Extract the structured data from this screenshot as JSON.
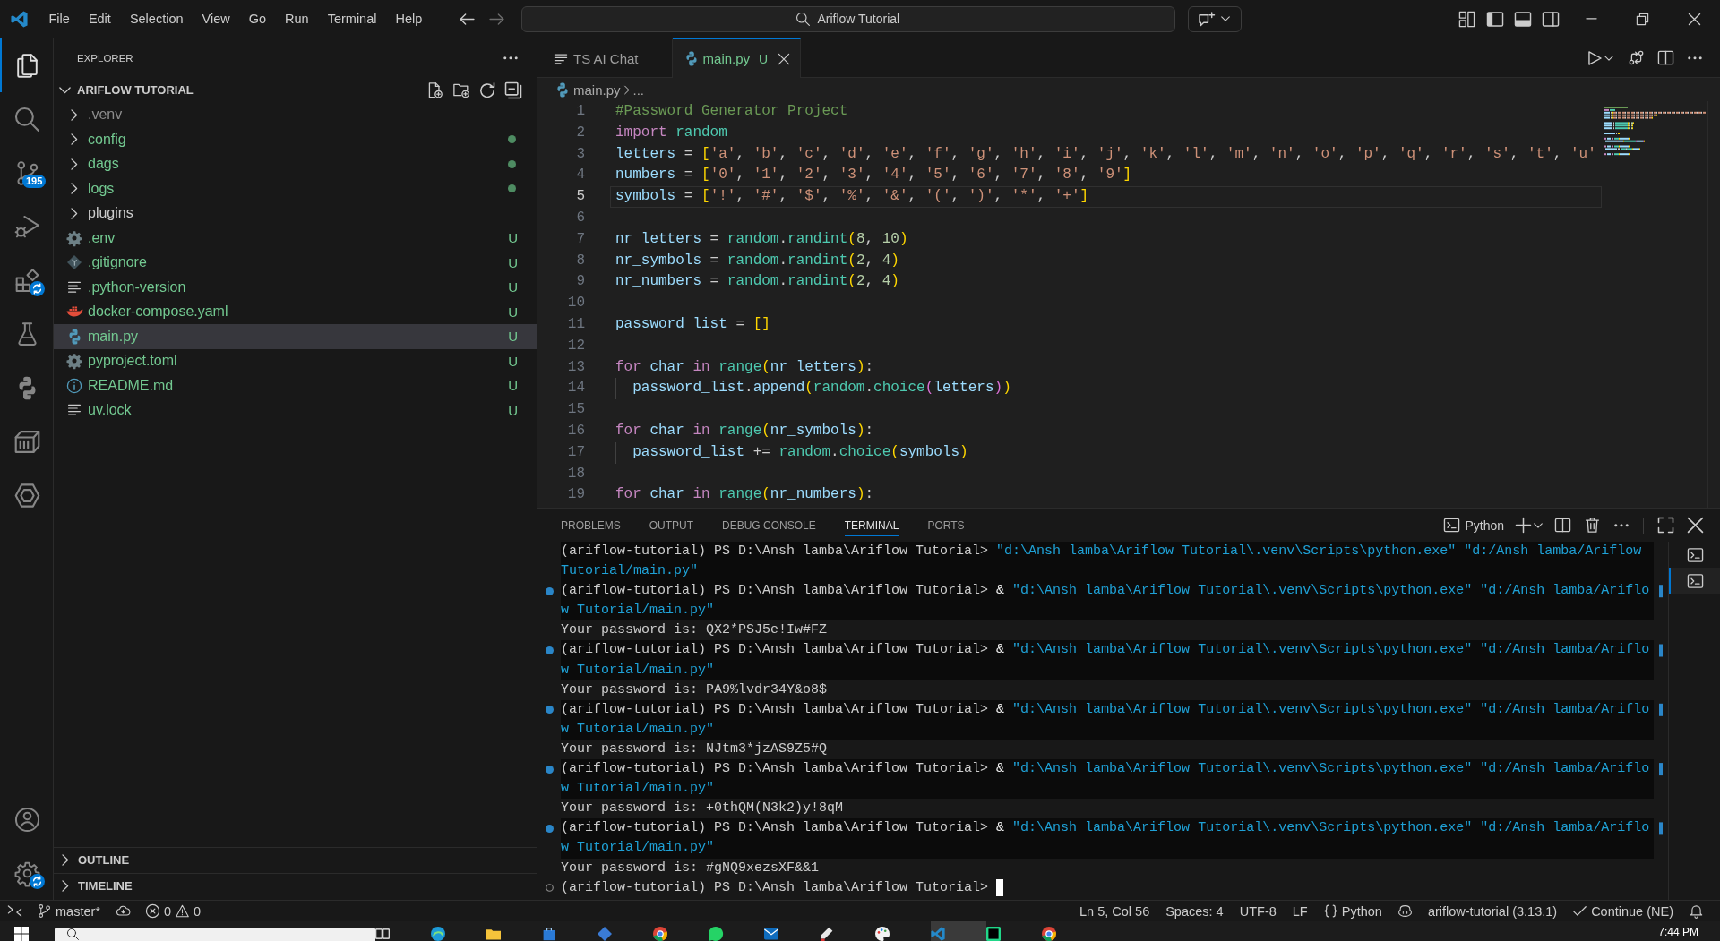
{
  "title_bar": {
    "menu": [
      "File",
      "Edit",
      "Selection",
      "View",
      "Go",
      "Run",
      "Terminal",
      "Help"
    ],
    "nav": [
      {
        "kind": "back",
        "disabled": false
      },
      {
        "kind": "forward",
        "disabled": true
      }
    ],
    "command_center": "Ariflow Tutorial",
    "layout": [
      {
        "kind": "primary-sidebar",
        "on": true
      },
      {
        "kind": "panel",
        "on": true
      },
      {
        "kind": "secondary-sidebar",
        "on": false
      }
    ]
  },
  "activity_bar": {
    "items": [
      {
        "kind": "explorer",
        "selected": true,
        "syncing": false
      },
      {
        "kind": "search",
        "selected": false,
        "syncing": false
      },
      {
        "kind": "source-control",
        "selected": false,
        "syncing": false,
        "badge": "195"
      },
      {
        "kind": "run-debug",
        "selected": false,
        "syncing": false
      },
      {
        "kind": "extensions",
        "selected": false,
        "syncing": true
      },
      {
        "kind": "testing",
        "selected": false,
        "syncing": false
      },
      {
        "kind": "python",
        "selected": false,
        "syncing": false
      },
      {
        "kind": "containers",
        "selected": false,
        "syncing": false
      },
      {
        "kind": "hexagon",
        "selected": false,
        "syncing": false
      }
    ],
    "bottom": [
      {
        "kind": "account",
        "syncing": false
      },
      {
        "kind": "manage",
        "syncing": true
      }
    ]
  },
  "sidebar": {
    "title": "EXPLORER",
    "root": {
      "label": "ARIFLOW TUTORIAL",
      "expanded": true,
      "children": [
        {
          "label": ".venv",
          "kind": "folder",
          "expanded": false,
          "ignored": true,
          "untracked": false,
          "selected": false
        },
        {
          "label": "config",
          "kind": "folder",
          "expanded": false,
          "ignored": false,
          "untracked": true,
          "selected": false
        },
        {
          "label": "dags",
          "kind": "folder",
          "expanded": false,
          "ignored": false,
          "untracked": true,
          "selected": false
        },
        {
          "label": "logs",
          "kind": "folder",
          "expanded": false,
          "ignored": false,
          "untracked": true,
          "selected": false
        },
        {
          "label": "plugins",
          "kind": "folder",
          "expanded": false,
          "ignored": false,
          "untracked": false,
          "selected": false
        },
        {
          "label": ".env",
          "kind": "settings",
          "ignored": false,
          "untracked": true,
          "badge": "U",
          "selected": false
        },
        {
          "label": ".gitignore",
          "kind": "git",
          "ignored": false,
          "untracked": true,
          "badge": "U",
          "selected": false
        },
        {
          "label": ".python-version",
          "kind": "text",
          "ignored": false,
          "untracked": true,
          "badge": "U",
          "selected": false
        },
        {
          "label": "docker-compose.yaml",
          "kind": "docker",
          "ignored": false,
          "untracked": true,
          "badge": "U",
          "selected": false
        },
        {
          "label": "main.py",
          "kind": "python",
          "ignored": false,
          "untracked": true,
          "badge": "U",
          "selected": true
        },
        {
          "label": "pyproject.toml",
          "kind": "settings",
          "ignored": false,
          "untracked": true,
          "badge": "U",
          "selected": false
        },
        {
          "label": "README.md",
          "kind": "info",
          "ignored": false,
          "untracked": true,
          "badge": "U",
          "selected": false
        },
        {
          "label": "uv.lock",
          "kind": "text",
          "ignored": false,
          "untracked": true,
          "badge": "U",
          "selected": false
        }
      ]
    },
    "sections": [
      {
        "label": "OUTLINE",
        "expanded": false
      },
      {
        "label": "TIMELINE",
        "expanded": false
      }
    ]
  },
  "editor": {
    "tabs": [
      {
        "label": "TS AI Chat",
        "kind": "chat",
        "untracked": false,
        "selected": false
      },
      {
        "label": "main.py",
        "kind": "python",
        "untracked": true,
        "badge": "U",
        "selected": true
      }
    ],
    "breadcrumb": [
      "main.py",
      "..."
    ],
    "lines": [
      {
        "number": "1",
        "current": false,
        "indented": false,
        "tokens": [
          {
            "kind": "comment",
            "text": "#Password Generator Project"
          }
        ]
      },
      {
        "number": "2",
        "current": false,
        "indented": false,
        "tokens": [
          {
            "kind": "keyword",
            "text": "import"
          },
          {
            "kind": "entity",
            "text": " random"
          }
        ]
      },
      {
        "number": "3",
        "current": false,
        "indented": false,
        "tokens": [
          {
            "kind": "name",
            "text": "letters"
          },
          {
            "kind": "plain",
            "text": " = "
          },
          {
            "kind": "bracket1",
            "text": "["
          },
          {
            "kind": "string",
            "text": "'a'"
          },
          {
            "kind": "plain",
            "text": ", "
          },
          {
            "kind": "string",
            "text": "'b'"
          },
          {
            "kind": "plain",
            "text": ", "
          },
          {
            "kind": "string",
            "text": "'c'"
          },
          {
            "kind": "plain",
            "text": ", "
          },
          {
            "kind": "string",
            "text": "'d'"
          },
          {
            "kind": "plain",
            "text": ", "
          },
          {
            "kind": "string",
            "text": "'e'"
          },
          {
            "kind": "plain",
            "text": ", "
          },
          {
            "kind": "string",
            "text": "'f'"
          },
          {
            "kind": "plain",
            "text": ", "
          },
          {
            "kind": "string",
            "text": "'g'"
          },
          {
            "kind": "plain",
            "text": ", "
          },
          {
            "kind": "string",
            "text": "'h'"
          },
          {
            "kind": "plain",
            "text": ", "
          },
          {
            "kind": "string",
            "text": "'i'"
          },
          {
            "kind": "plain",
            "text": ", "
          },
          {
            "kind": "string",
            "text": "'j'"
          },
          {
            "kind": "plain",
            "text": ", "
          },
          {
            "kind": "string",
            "text": "'k'"
          },
          {
            "kind": "plain",
            "text": ", "
          },
          {
            "kind": "string",
            "text": "'l'"
          },
          {
            "kind": "plain",
            "text": ", "
          },
          {
            "kind": "string",
            "text": "'m'"
          },
          {
            "kind": "plain",
            "text": ", "
          },
          {
            "kind": "string",
            "text": "'n'"
          },
          {
            "kind": "plain",
            "text": ", "
          },
          {
            "kind": "string",
            "text": "'o'"
          },
          {
            "kind": "plain",
            "text": ", "
          },
          {
            "kind": "string",
            "text": "'p'"
          },
          {
            "kind": "plain",
            "text": ", "
          },
          {
            "kind": "string",
            "text": "'q'"
          },
          {
            "kind": "plain",
            "text": ", "
          },
          {
            "kind": "string",
            "text": "'r'"
          },
          {
            "kind": "plain",
            "text": ", "
          },
          {
            "kind": "string",
            "text": "'s'"
          },
          {
            "kind": "plain",
            "text": ", "
          },
          {
            "kind": "string",
            "text": "'t'"
          },
          {
            "kind": "plain",
            "text": ", "
          },
          {
            "kind": "string",
            "text": "'u'"
          }
        ]
      },
      {
        "number": "4",
        "current": false,
        "indented": false,
        "tokens": [
          {
            "kind": "name",
            "text": "numbers"
          },
          {
            "kind": "plain",
            "text": " = "
          },
          {
            "kind": "bracket1",
            "text": "["
          },
          {
            "kind": "string",
            "text": "'0'"
          },
          {
            "kind": "plain",
            "text": ", "
          },
          {
            "kind": "string",
            "text": "'1'"
          },
          {
            "kind": "plain",
            "text": ", "
          },
          {
            "kind": "string",
            "text": "'2'"
          },
          {
            "kind": "plain",
            "text": ", "
          },
          {
            "kind": "string",
            "text": "'3'"
          },
          {
            "kind": "plain",
            "text": ", "
          },
          {
            "kind": "string",
            "text": "'4'"
          },
          {
            "kind": "plain",
            "text": ", "
          },
          {
            "kind": "string",
            "text": "'5'"
          },
          {
            "kind": "plain",
            "text": ", "
          },
          {
            "kind": "string",
            "text": "'6'"
          },
          {
            "kind": "plain",
            "text": ", "
          },
          {
            "kind": "string",
            "text": "'7'"
          },
          {
            "kind": "plain",
            "text": ", "
          },
          {
            "kind": "string",
            "text": "'8'"
          },
          {
            "kind": "plain",
            "text": ", "
          },
          {
            "kind": "string",
            "text": "'9'"
          },
          {
            "kind": "bracket1",
            "text": "]"
          }
        ]
      },
      {
        "number": "5",
        "current": true,
        "indented": false,
        "tokens": [
          {
            "kind": "name",
            "text": "symbols"
          },
          {
            "kind": "plain",
            "text": " = "
          },
          {
            "kind": "bracket1",
            "text": "["
          },
          {
            "kind": "string",
            "text": "'!'"
          },
          {
            "kind": "plain",
            "text": ", "
          },
          {
            "kind": "string",
            "text": "'#'"
          },
          {
            "kind": "plain",
            "text": ", "
          },
          {
            "kind": "string",
            "text": "'$'"
          },
          {
            "kind": "plain",
            "text": ", "
          },
          {
            "kind": "string",
            "text": "'%'"
          },
          {
            "kind": "plain",
            "text": ", "
          },
          {
            "kind": "string",
            "text": "'&'"
          },
          {
            "kind": "plain",
            "text": ", "
          },
          {
            "kind": "string",
            "text": "'('"
          },
          {
            "kind": "plain",
            "text": ", "
          },
          {
            "kind": "string",
            "text": "')'"
          },
          {
            "kind": "plain",
            "text": ", "
          },
          {
            "kind": "string",
            "text": "'*'"
          },
          {
            "kind": "plain",
            "text": ", "
          },
          {
            "kind": "string",
            "text": "'+'"
          },
          {
            "kind": "bracket1",
            "text": "]"
          }
        ]
      },
      {
        "number": "6",
        "current": false
      },
      {
        "number": "7",
        "current": false,
        "indented": false,
        "tokens": [
          {
            "kind": "name",
            "text": "nr_letters"
          },
          {
            "kind": "plain",
            "text": " = "
          },
          {
            "kind": "entity",
            "text": "random"
          },
          {
            "kind": "plain",
            "text": "."
          },
          {
            "kind": "entity",
            "text": "randint"
          },
          {
            "kind": "bracket1",
            "text": "("
          },
          {
            "kind": "number",
            "text": "8"
          },
          {
            "kind": "plain",
            "text": ", "
          },
          {
            "kind": "number",
            "text": "10"
          },
          {
            "kind": "bracket1",
            "text": ")"
          }
        ]
      },
      {
        "number": "8",
        "current": false,
        "indented": false,
        "tokens": [
          {
            "kind": "name",
            "text": "nr_symbols"
          },
          {
            "kind": "plain",
            "text": " = "
          },
          {
            "kind": "entity",
            "text": "random"
          },
          {
            "kind": "plain",
            "text": "."
          },
          {
            "kind": "entity",
            "text": "randint"
          },
          {
            "kind": "bracket1",
            "text": "("
          },
          {
            "kind": "number",
            "text": "2"
          },
          {
            "kind": "plain",
            "text": ", "
          },
          {
            "kind": "number",
            "text": "4"
          },
          {
            "kind": "bracket1",
            "text": ")"
          }
        ]
      },
      {
        "number": "9",
        "current": false,
        "indented": false,
        "tokens": [
          {
            "kind": "name",
            "text": "nr_numbers"
          },
          {
            "kind": "plain",
            "text": " = "
          },
          {
            "kind": "entity",
            "text": "random"
          },
          {
            "kind": "plain",
            "text": "."
          },
          {
            "kind": "entity",
            "text": "randint"
          },
          {
            "kind": "bracket1",
            "text": "("
          },
          {
            "kind": "number",
            "text": "2"
          },
          {
            "kind": "plain",
            "text": ", "
          },
          {
            "kind": "number",
            "text": "4"
          },
          {
            "kind": "bracket1",
            "text": ")"
          }
        ]
      },
      {
        "number": "10",
        "current": false
      },
      {
        "number": "11",
        "current": false,
        "indented": false,
        "tokens": [
          {
            "kind": "name",
            "text": "password_list"
          },
          {
            "kind": "plain",
            "text": " = "
          },
          {
            "kind": "bracket1",
            "text": "[]"
          }
        ]
      },
      {
        "number": "12",
        "current": false
      },
      {
        "number": "13",
        "current": false,
        "indented": false,
        "tokens": [
          {
            "kind": "keyword",
            "text": "for"
          },
          {
            "kind": "name",
            "text": " char"
          },
          {
            "kind": "keyword",
            "text": " in"
          },
          {
            "kind": "entity",
            "text": " range"
          },
          {
            "kind": "bracket1",
            "text": "("
          },
          {
            "kind": "name",
            "text": "nr_letters"
          },
          {
            "kind": "bracket1",
            "text": ")"
          },
          {
            "kind": "plain",
            "text": ":"
          }
        ]
      },
      {
        "number": "14",
        "current": false,
        "indented": true,
        "tokens": [
          {
            "kind": "name",
            "text": "password_list"
          },
          {
            "kind": "plain",
            "text": "."
          },
          {
            "kind": "name",
            "text": "append"
          },
          {
            "kind": "bracket1",
            "text": "("
          },
          {
            "kind": "entity",
            "text": "random"
          },
          {
            "kind": "plain",
            "text": "."
          },
          {
            "kind": "entity",
            "text": "choice"
          },
          {
            "kind": "bracket2",
            "text": "("
          },
          {
            "kind": "name",
            "text": "letters"
          },
          {
            "kind": "bracket2",
            "text": ")"
          },
          {
            "kind": "bracket1",
            "text": ")"
          }
        ]
      },
      {
        "number": "15",
        "current": false
      },
      {
        "number": "16",
        "current": false,
        "indented": false,
        "tokens": [
          {
            "kind": "keyword",
            "text": "for"
          },
          {
            "kind": "name",
            "text": " char"
          },
          {
            "kind": "keyword",
            "text": " in"
          },
          {
            "kind": "entity",
            "text": " range"
          },
          {
            "kind": "bracket1",
            "text": "("
          },
          {
            "kind": "name",
            "text": "nr_symbols"
          },
          {
            "kind": "bracket1",
            "text": ")"
          },
          {
            "kind": "plain",
            "text": ":"
          }
        ]
      },
      {
        "number": "17",
        "current": false,
        "indented": true,
        "tokens": [
          {
            "kind": "name",
            "text": "password_list"
          },
          {
            "kind": "plain",
            "text": " += "
          },
          {
            "kind": "entity",
            "text": "random"
          },
          {
            "kind": "plain",
            "text": "."
          },
          {
            "kind": "entity",
            "text": "choice"
          },
          {
            "kind": "bracket1",
            "text": "("
          },
          {
            "kind": "name",
            "text": "symbols"
          },
          {
            "kind": "bracket1",
            "text": ")"
          }
        ]
      },
      {
        "number": "18",
        "current": false
      },
      {
        "number": "19",
        "current": false,
        "indented": false,
        "tokens": [
          {
            "kind": "keyword",
            "text": "for"
          },
          {
            "kind": "name",
            "text": " char"
          },
          {
            "kind": "keyword",
            "text": " in"
          },
          {
            "kind": "entity",
            "text": " range"
          },
          {
            "kind": "bracket1",
            "text": "("
          },
          {
            "kind": "name",
            "text": "nr_numbers"
          },
          {
            "kind": "bracket1",
            "text": ")"
          },
          {
            "kind": "plain",
            "text": ":"
          }
        ]
      }
    ]
  },
  "panel": {
    "tabs": [
      {
        "label": "PROBLEMS",
        "selected": false
      },
      {
        "label": "OUTPUT",
        "selected": false
      },
      {
        "label": "DEBUG CONSOLE",
        "selected": false
      },
      {
        "label": "TERMINAL",
        "selected": true
      },
      {
        "label": "PORTS",
        "selected": false
      }
    ],
    "shell": "Python",
    "terminal_list": [
      {
        "selected": false
      },
      {
        "selected": true
      }
    ],
    "terminal": [
      {
        "kind": "command",
        "succeeded": false,
        "prompt": "(ariflow-tutorial) PS D:\\Ansh lamba\\Ariflow Tutorial>",
        "args": "\"d:\\Ansh lamba\\Ariflow Tutorial\\.venv\\Scripts\\python.exe\" \"d:/Ansh lamba/Ariflow"
      },
      {
        "kind": "wrap",
        "text": "Tutorial/main.py\""
      },
      {
        "kind": "command",
        "succeeded": true,
        "prompt": "(ariflow-tutorial) PS D:\\Ansh lamba\\Ariflow Tutorial>",
        "operator": "&",
        "args": "\"d:\\Ansh lamba\\Ariflow Tutorial\\.venv\\Scripts\\python.exe\" \"d:/Ansh lamba/Ariflo"
      },
      {
        "kind": "wrap",
        "text": "w Tutorial/main.py\""
      },
      {
        "kind": "output",
        "text": "Your password is: QX2*PSJ5e!Iw#FZ"
      },
      {
        "kind": "command",
        "succeeded": true,
        "prompt": "(ariflow-tutorial) PS D:\\Ansh lamba\\Ariflow Tutorial>",
        "operator": "&",
        "args": "\"d:\\Ansh lamba\\Ariflow Tutorial\\.venv\\Scripts\\python.exe\" \"d:/Ansh lamba/Ariflo"
      },
      {
        "kind": "wrap",
        "text": "w Tutorial/main.py\""
      },
      {
        "kind": "output",
        "text": "Your password is: PA9%lvdr34Y&o8$"
      },
      {
        "kind": "command",
        "succeeded": true,
        "prompt": "(ariflow-tutorial) PS D:\\Ansh lamba\\Ariflow Tutorial>",
        "operator": "&",
        "args": "\"d:\\Ansh lamba\\Ariflow Tutorial\\.venv\\Scripts\\python.exe\" \"d:/Ansh lamba/Ariflo"
      },
      {
        "kind": "wrap",
        "text": "w Tutorial/main.py\""
      },
      {
        "kind": "output",
        "text": "Your password is: NJtm3*jzAS9Z5#Q"
      },
      {
        "kind": "command",
        "succeeded": true,
        "prompt": "(ariflow-tutorial) PS D:\\Ansh lamba\\Ariflow Tutorial>",
        "operator": "&",
        "args": "\"d:\\Ansh lamba\\Ariflow Tutorial\\.venv\\Scripts\\python.exe\" \"d:/Ansh lamba/Ariflo"
      },
      {
        "kind": "wrap",
        "text": "w Tutorial/main.py\""
      },
      {
        "kind": "output",
        "text": "Your password is: +0thQM(N3k2)y!8qM"
      },
      {
        "kind": "command",
        "succeeded": true,
        "prompt": "(ariflow-tutorial) PS D:\\Ansh lamba\\Ariflow Tutorial>",
        "operator": "&",
        "args": "\"d:\\Ansh lamba\\Ariflow Tutorial\\.venv\\Scripts\\python.exe\" \"d:/Ansh lamba/Ariflo"
      },
      {
        "kind": "wrap",
        "text": "w Tutorial/main.py\""
      },
      {
        "kind": "output",
        "text": "Your password is: #gNQ9xezsXF&&1"
      },
      {
        "kind": "prompt",
        "prompt": "(ariflow-tutorial) PS D:\\Ansh lamba\\Ariflow Tutorial>"
      }
    ]
  },
  "status_bar": {
    "branch": "master*",
    "problems": [
      {
        "kind": "error",
        "count": "0"
      },
      {
        "kind": "warning",
        "count": "0"
      }
    ],
    "items": [
      {
        "kind": "text",
        "text": "Ln 5, Col 56"
      },
      {
        "kind": "text",
        "text": "Spaces: 4"
      },
      {
        "kind": "text",
        "text": "UTF-8"
      },
      {
        "kind": "text",
        "text": "LF"
      },
      {
        "kind": "language",
        "text": "Python"
      },
      {
        "kind": "assistant"
      },
      {
        "kind": "text",
        "text": "ariflow-tutorial (3.13.1)"
      },
      {
        "kind": "check",
        "text": "Continue (NE)"
      },
      {
        "kind": "notifications"
      }
    ]
  },
  "taskbar": {
    "apps": [
      {
        "kind": "panes",
        "active": false
      },
      {
        "kind": "wave",
        "active": false
      },
      {
        "kind": "folder",
        "active": false
      },
      {
        "kind": "bag",
        "active": false
      },
      {
        "kind": "diamond",
        "active": false
      },
      {
        "kind": "ring",
        "active": false
      },
      {
        "kind": "chat",
        "active": false
      },
      {
        "kind": "envelope",
        "active": false
      },
      {
        "kind": "pen",
        "active": false
      },
      {
        "kind": "palette",
        "active": false
      },
      {
        "kind": "editor",
        "active": true
      },
      {
        "kind": "tile",
        "active": false
      },
      {
        "kind": "ring",
        "active": false
      }
    ],
    "time": "7:44 PM"
  }
}
